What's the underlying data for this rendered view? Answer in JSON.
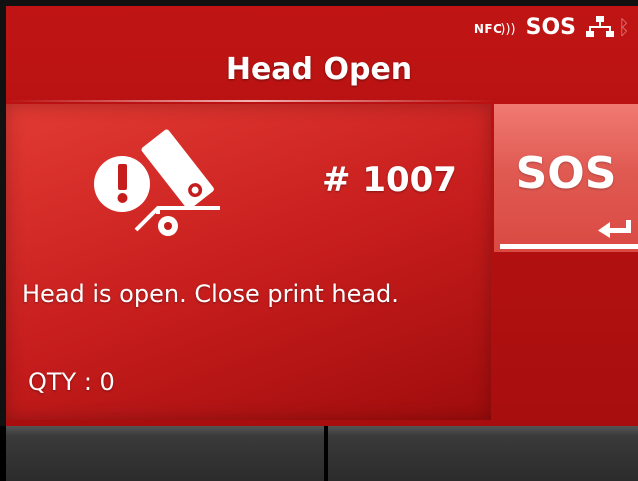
{
  "status_bar": {
    "nfc_label": "NFC",
    "sos_label": "SOS",
    "icons": [
      "nfc-icon",
      "network-icon",
      "bluetooth-icon"
    ]
  },
  "header": {
    "title": "Head Open"
  },
  "error": {
    "icon": "head-open-icon",
    "code": "# 1007",
    "message": "Head is open. Close print head.",
    "qty_label": "QTY : 0"
  },
  "sos_button": {
    "label": "SOS",
    "icon": "enter-icon"
  },
  "softkeys": {
    "left_label": "",
    "right_label": ""
  },
  "colors": {
    "background": "#b11010",
    "panel": "#d32a26",
    "sos_button": "#e05a52",
    "text": "#ffffff"
  }
}
